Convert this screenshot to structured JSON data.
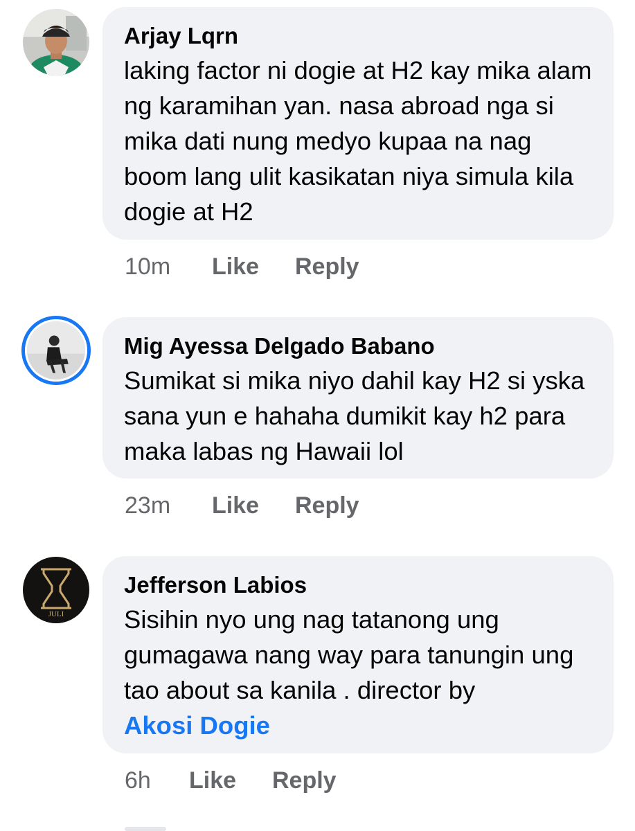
{
  "comments": [
    {
      "author": "Arjay Lqrn",
      "text": "laking factor ni dogie at H2 kay mika alam ng karamihan yan. nasa abroad nga si mika dati nung medyo kupaa na nag boom lang ulit kasikatan niya simula kila dogie at H2",
      "time": "10m",
      "like_label": "Like",
      "reply_label": "Reply"
    },
    {
      "author": "Mig Ayessa Delgado Babano",
      "text": "Sumikat si mika niyo dahil kay H2 si yska sana yun e hahaha dumikit kay h2 para maka labas ng Hawaii lol",
      "time": "23m",
      "like_label": "Like",
      "reply_label": "Reply"
    },
    {
      "author": "Jefferson Labios",
      "text": "Sisihin nyo ung nag tatanong ung gumagawa nang way para tanungin ung tao about sa kanila . director by",
      "mention": "Akosi Dogie",
      "time": "6h",
      "like_label": "Like",
      "reply_label": "Reply",
      "avatar_logo_text": "JULI"
    }
  ],
  "colors": {
    "bubble": "#f0f2f5",
    "text": "#050505",
    "meta": "#65676b",
    "mention": "#1877f2",
    "story_ring": "#1877f2"
  },
  "icons": {
    "avatar_1": "user-photo-avatar",
    "avatar_2": "user-photo-avatar-with-story-ring",
    "avatar_3": "hourglass-logo-avatar"
  }
}
